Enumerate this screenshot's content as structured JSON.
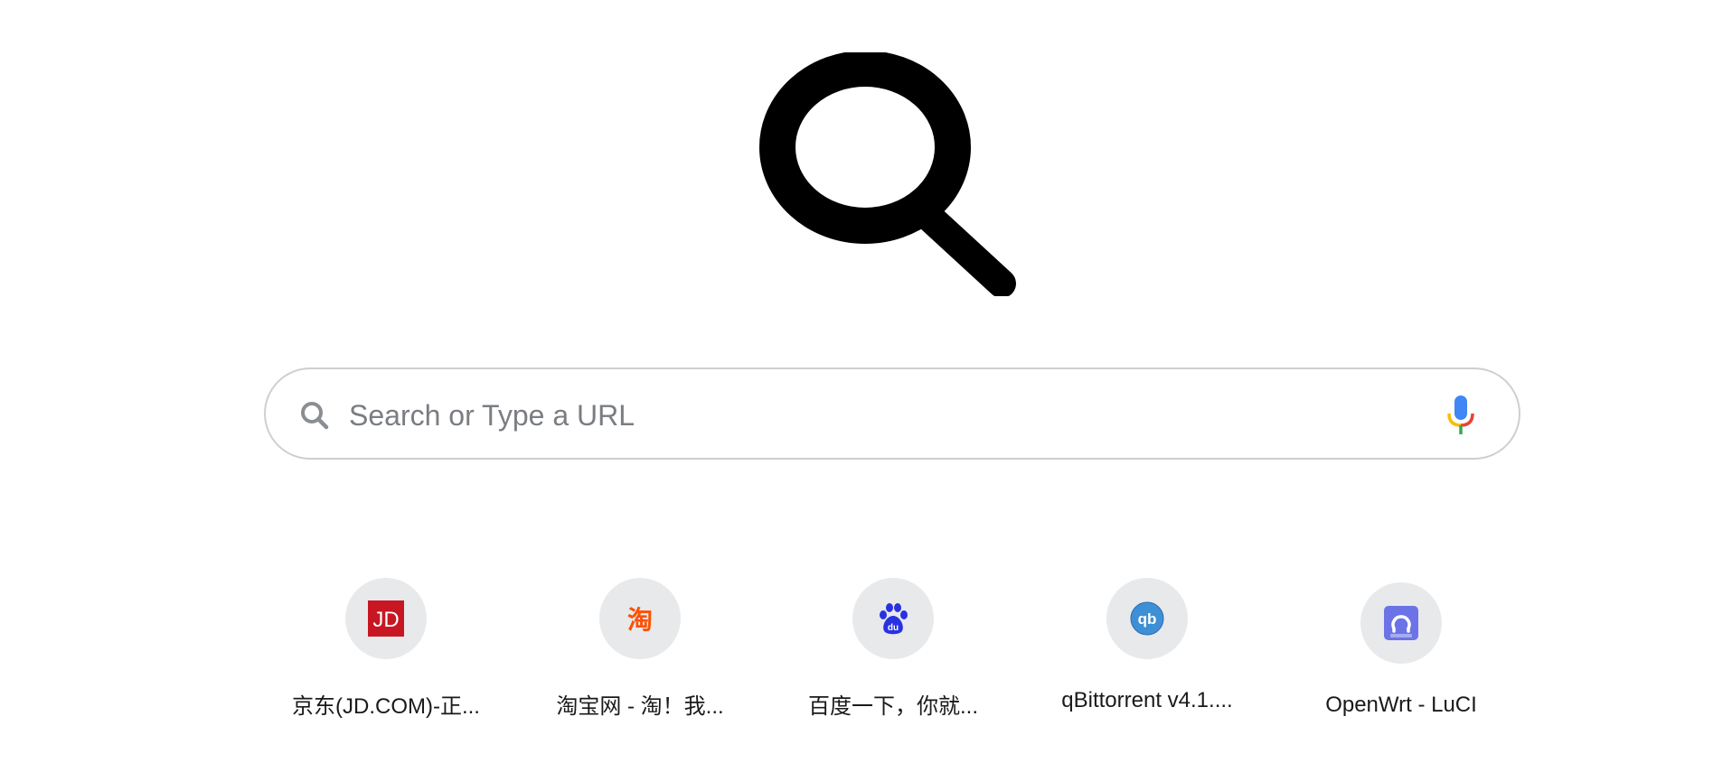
{
  "search": {
    "placeholder": "Search or Type a URL",
    "value": ""
  },
  "icons": {
    "logo": "magnifier-logo-icon",
    "search": "search-icon",
    "mic": "microphone-icon"
  },
  "shortcuts": [
    {
      "label": "京东(JD.COM)-正...",
      "icon": "jd-favicon",
      "icon_text": "JD",
      "color": "#c81623"
    },
    {
      "label": "淘宝网 - 淘！我...",
      "icon": "taobao-favicon",
      "icon_text": "淘",
      "color": "#ff5000"
    },
    {
      "label": "百度一下，你就...",
      "icon": "baidu-favicon",
      "icon_text": "du",
      "color": "#2932e1"
    },
    {
      "label": "qBittorrent v4.1....",
      "icon": "qbittorrent-favicon",
      "icon_text": "qb",
      "color": "#3d8fd6"
    },
    {
      "label": "OpenWrt - LuCI",
      "icon": "openwrt-favicon",
      "icon_text": "",
      "color": "#6b73e6"
    }
  ],
  "colors": {
    "logo": "#000000",
    "search_border": "#cfcfcf",
    "placeholder": "#7a7d82",
    "tile_bg": "#e8e9eb",
    "mic_blue": "#4285f4",
    "mic_red": "#ea4335",
    "mic_yellow": "#fbbc05",
    "mic_green": "#34a853"
  }
}
